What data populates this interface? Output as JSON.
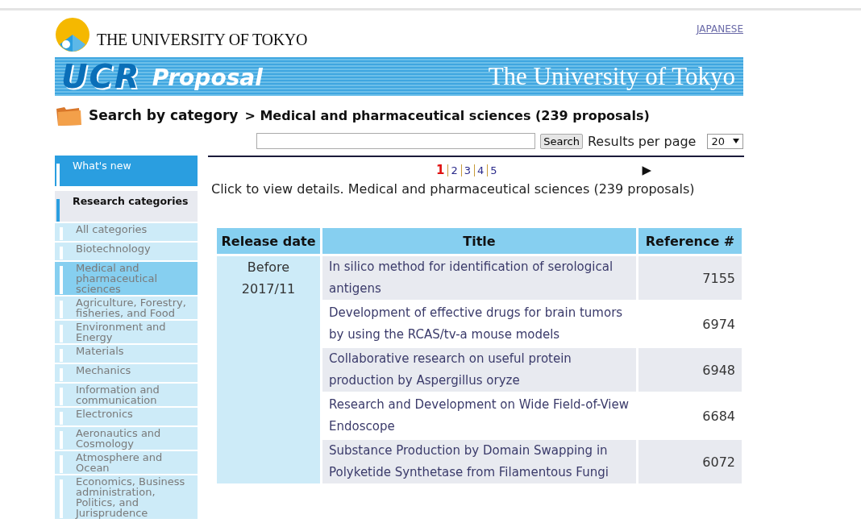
{
  "header": {
    "logo_text": "THE UNIVERSITY OF TOKYO",
    "language_link": "JAPANESE"
  },
  "banner": {
    "brand": "UCR",
    "subtitle": "Proposal",
    "title": "The University of Tokyo"
  },
  "breadcrumb": {
    "root": "Search by category",
    "current": "> Medical and pharmaceutical sciences (239 proposals)"
  },
  "search": {
    "button": "Search",
    "results_label": "Results per page",
    "per_page": "20"
  },
  "sidebar": {
    "items": [
      {
        "kind": "news",
        "label": "What's new"
      },
      {
        "kind": "section",
        "label": "Research categories"
      },
      {
        "kind": "category",
        "label": "All categories",
        "selected": false
      },
      {
        "kind": "category",
        "label": "Biotechnology",
        "selected": false
      },
      {
        "kind": "category",
        "label": "Medical and pharmaceutical sciences",
        "selected": true
      },
      {
        "kind": "category",
        "label": "Agriculture, Forestry, fisheries, and Food",
        "selected": false
      },
      {
        "kind": "category",
        "label": "Environment and Energy",
        "selected": false
      },
      {
        "kind": "category",
        "label": "Materials",
        "selected": false
      },
      {
        "kind": "category",
        "label": "Mechanics",
        "selected": false
      },
      {
        "kind": "category",
        "label": "Information and communication",
        "selected": false
      },
      {
        "kind": "category",
        "label": "Electronics",
        "selected": false
      },
      {
        "kind": "category",
        "label": "Aeronautics and Cosmology",
        "selected": false
      },
      {
        "kind": "category",
        "label": "Atmosphere and Ocean",
        "selected": false
      },
      {
        "kind": "category",
        "label": "Economics, Business administration, Politics, and Jurisprudence",
        "selected": false
      }
    ]
  },
  "pagination": {
    "pages": [
      {
        "label": "1",
        "selected": true
      },
      {
        "label": "2",
        "selected": false
      },
      {
        "label": "3",
        "selected": false
      },
      {
        "label": "4",
        "selected": false
      },
      {
        "label": "5",
        "selected": false
      }
    ],
    "next": "▶"
  },
  "intro": "Click to view details.  Medical and pharmaceutical sciences (239 proposals)",
  "table": {
    "columns": [
      "Release date",
      "Title",
      "Reference #"
    ],
    "release_group": "Before 2017/11",
    "rows": [
      {
        "title": "In silico method for identification of serological antigens",
        "reference": "7155"
      },
      {
        "title": "Development of effective drugs for brain tumors by using the RCAS/tv-a mouse models",
        "reference": "6974"
      },
      {
        "title": "Collaborative research on useful protein production by Aspergillus oryze",
        "reference": "6948"
      },
      {
        "title": "Research and Development on Wide Field-of-View Endoscope",
        "reference": "6684"
      },
      {
        "title": "Substance Production by Domain Swapping in Polyketide Synthetase from Filamentous Fungi",
        "reference": "6072"
      }
    ]
  }
}
